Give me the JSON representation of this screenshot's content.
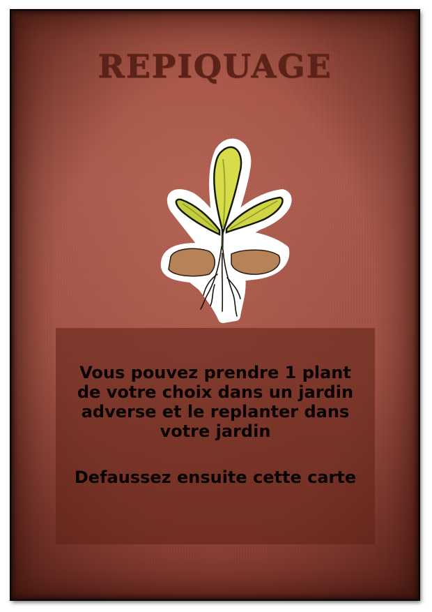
{
  "card": {
    "title": "REPIQUAGE",
    "rules_text": "Vous pouvez prendre 1 plant de votre choix dans un jardin adverse et le replanter dans votre jardin",
    "discard_text": "Defaussez ensuite cette carte",
    "illustration_icon": "seedling-with-roots-icon"
  },
  "colors": {
    "card_background": "#a24c3e",
    "title": "#5a2218",
    "text_panel": "#5f2016",
    "text": "#0a0303"
  }
}
